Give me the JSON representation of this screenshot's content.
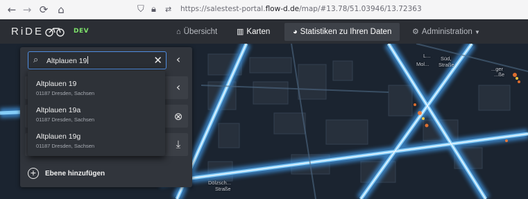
{
  "browser": {
    "url_prefix": "https://salestest-portal.",
    "url_domain": "flow-d.de",
    "url_suffix": "/map/#13.78/51.03946/13.72363"
  },
  "app": {
    "logo_text": "RiDE",
    "env_badge": "DEV",
    "nav": {
      "overview": "Übersicht",
      "maps": "Karten",
      "stats": "Statistiken zu Ihren Daten",
      "admin": "Administration"
    }
  },
  "map": {
    "labels": [
      "L...",
      "Süd,",
      "Mol...",
      "Straße",
      "...ger",
      "...ße",
      "Dölzsch...",
      "Straße"
    ]
  },
  "panel": {
    "search_value": "Altplauen 19",
    "add_layer_label": "Ebene hinzufügen",
    "suggestions": [
      {
        "title": "Altplauen 19",
        "subtitle": "01187 Dresden, Sachsen"
      },
      {
        "title": "Altplauen 19a",
        "subtitle": "01187 Dresden, Sachsen"
      },
      {
        "title": "Altplauen 19g",
        "subtitle": "01187 Dresden, Sachsen"
      }
    ]
  },
  "colors": {
    "accent": "#4f8de0",
    "env_badge": "#7ee26b",
    "header_bg": "#2b2e34",
    "panel_bg": "#31353c",
    "map_bg": "#1b2430",
    "flow_line": "#8ed6ff"
  }
}
